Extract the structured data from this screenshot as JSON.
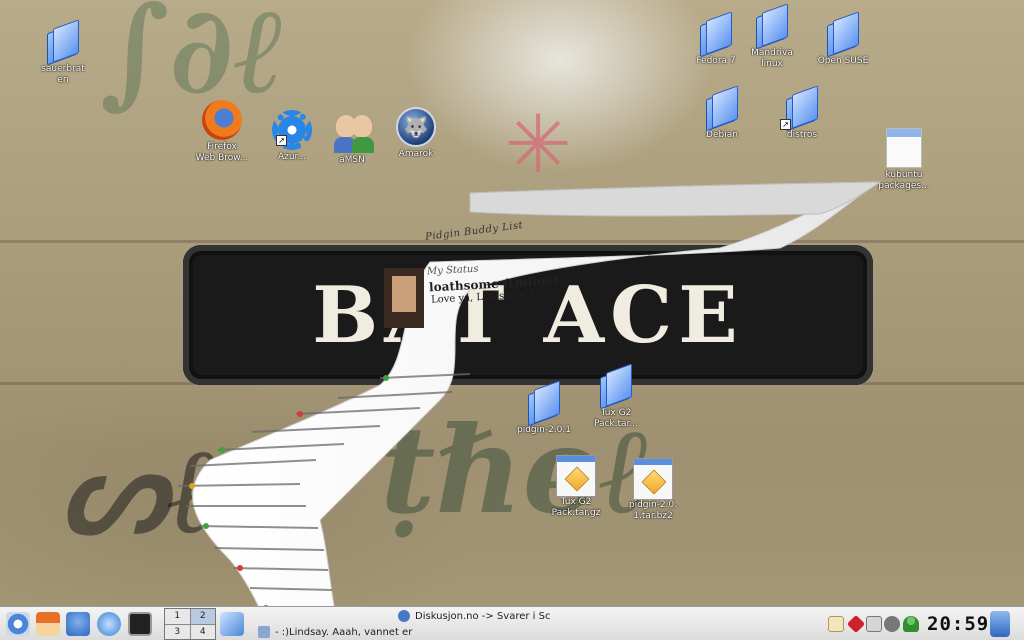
{
  "wallpaper": {
    "sign_text": "BAT ACE"
  },
  "desktop_icons": [
    {
      "id": "sauerbraten",
      "label": "sauerbrat\nen"
    },
    {
      "id": "firefox",
      "label": "Firefox\nWeb Brow..."
    },
    {
      "id": "azureus",
      "label": "Azur..."
    },
    {
      "id": "amsn",
      "label": "aMSN"
    },
    {
      "id": "amarok",
      "label": "Amarok"
    },
    {
      "id": "fedora7",
      "label": "Fedora 7"
    },
    {
      "id": "mandriva",
      "label": "Mandriva\nlinux"
    },
    {
      "id": "opensuse",
      "label": "Open SUSE"
    },
    {
      "id": "debian",
      "label": "Debian"
    },
    {
      "id": "distros",
      "label": "distros"
    },
    {
      "id": "kubuntu",
      "label": "kubuntu\npackages..."
    },
    {
      "id": "pidgin_folder",
      "label": "pidgin-2.0.1"
    },
    {
      "id": "tux_folder",
      "label": "Tux G2\nPack.tar..."
    },
    {
      "id": "tux_pack",
      "label": "Tux G2\nPack.tar.gz"
    },
    {
      "id": "pidgin_tar",
      "label": "pidgin-2.0.\n1.tar.bz2"
    }
  ],
  "wobbly_window": {
    "title": "Pidgin Buddy List",
    "status_label": "My Status",
    "status_name": "loathsome (Online)",
    "status_message": "Love ya, Lindsay <3"
  },
  "taskbar": {
    "pager": [
      "1",
      "2",
      "3",
      "4"
    ],
    "active_desktop": "2",
    "tasks": [
      {
        "label": "Diskusjon.no -> Svarer i Sc"
      },
      {
        "label": "- :)Lindsay. Aaah, vannet er"
      }
    ],
    "clock": "20:59"
  },
  "colors": {
    "folder_blue": "#3a78e0",
    "taskbar_bg": "#e6e6e6"
  }
}
